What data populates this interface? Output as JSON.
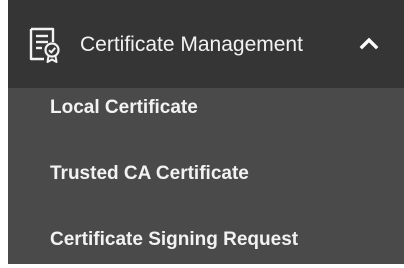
{
  "menu": {
    "header": {
      "label": "Certificate Management",
      "icon": "certificate-document-icon",
      "toggle_icon": "chevron-up-icon",
      "expanded": true
    },
    "items": [
      {
        "label": "Local Certificate"
      },
      {
        "label": "Trusted CA Certificate"
      },
      {
        "label": "Certificate Signing Request"
      }
    ]
  },
  "colors": {
    "header_background": "#353535",
    "submenu_background": "#4a4a4a",
    "text": "#f2f2f2"
  }
}
